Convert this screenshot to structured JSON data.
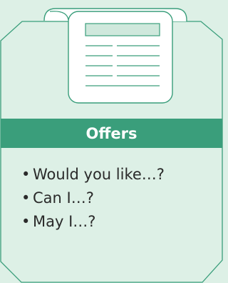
{
  "card": {
    "title": "Offers",
    "items": [
      {
        "bullet": "•",
        "text": "Would you like…?"
      },
      {
        "bullet": "•",
        "text": "Can I…?"
      },
      {
        "bullet": "•",
        "text": "May I…?"
      }
    ]
  },
  "icon": "document-form-icon",
  "colors": {
    "background": "#ddf0e6",
    "accent": "#3a9e7b",
    "text": "#2a2a2a",
    "paper": "#ffffff"
  }
}
